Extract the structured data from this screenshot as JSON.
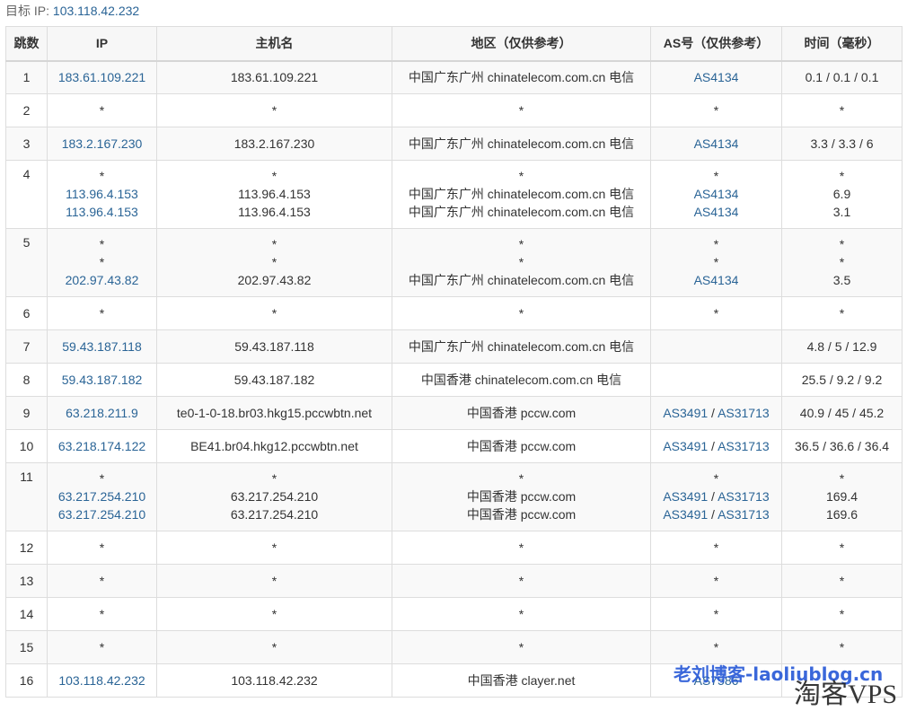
{
  "target": {
    "label": "目标 IP:",
    "ip": "103.118.42.232"
  },
  "headers": [
    "跳数",
    "IP",
    "主机名",
    "地区（仅供参考）",
    "AS号（仅供参考）",
    "时间（毫秒）"
  ],
  "rows": [
    {
      "hop": "1",
      "lines": [
        {
          "ip": "183.61.109.221",
          "host": "183.61.109.221",
          "region": "中国广东广州 chinatelecom.com.cn 电信",
          "as": [
            "AS4134"
          ],
          "time": "0.1 / 0.1 / 0.1"
        }
      ]
    },
    {
      "hop": "2",
      "lines": [
        {
          "ip": "*",
          "host": "*",
          "region": "*",
          "as": [
            "*"
          ],
          "time": "*"
        }
      ]
    },
    {
      "hop": "3",
      "lines": [
        {
          "ip": "183.2.167.230",
          "host": "183.2.167.230",
          "region": "中国广东广州 chinatelecom.com.cn 电信",
          "as": [
            "AS4134"
          ],
          "time": "3.3 / 3.3 / 6"
        }
      ]
    },
    {
      "hop": "4",
      "lines": [
        {
          "ip": "*",
          "host": "*",
          "region": "*",
          "as": [
            "*"
          ],
          "time": "*"
        },
        {
          "ip": "113.96.4.153",
          "host": "113.96.4.153",
          "region": "中国广东广州 chinatelecom.com.cn 电信",
          "as": [
            "AS4134"
          ],
          "time": "6.9"
        },
        {
          "ip": "113.96.4.153",
          "host": "113.96.4.153",
          "region": "中国广东广州 chinatelecom.com.cn 电信",
          "as": [
            "AS4134"
          ],
          "time": "3.1"
        }
      ]
    },
    {
      "hop": "5",
      "lines": [
        {
          "ip": "*",
          "host": "*",
          "region": "*",
          "as": [
            "*"
          ],
          "time": "*"
        },
        {
          "ip": "*",
          "host": "*",
          "region": "*",
          "as": [
            "*"
          ],
          "time": "*"
        },
        {
          "ip": "202.97.43.82",
          "host": "202.97.43.82",
          "region": "中国广东广州 chinatelecom.com.cn 电信",
          "as": [
            "AS4134"
          ],
          "time": "3.5"
        }
      ]
    },
    {
      "hop": "6",
      "lines": [
        {
          "ip": "*",
          "host": "*",
          "region": "*",
          "as": [
            "*"
          ],
          "time": "*"
        }
      ]
    },
    {
      "hop": "7",
      "lines": [
        {
          "ip": "59.43.187.118",
          "host": "59.43.187.118",
          "region": "中国广东广州 chinatelecom.com.cn 电信",
          "as": [],
          "time": "4.8 / 5 / 12.9"
        }
      ]
    },
    {
      "hop": "8",
      "lines": [
        {
          "ip": "59.43.187.182",
          "host": "59.43.187.182",
          "region": "中国香港 chinatelecom.com.cn 电信",
          "as": [],
          "time": "25.5 / 9.2 / 9.2"
        }
      ]
    },
    {
      "hop": "9",
      "lines": [
        {
          "ip": "63.218.211.9",
          "host": "te0-1-0-18.br03.hkg15.pccwbtn.net",
          "region": "中国香港 pccw.com",
          "as": [
            "AS3491",
            "AS31713"
          ],
          "time": "40.9 / 45 / 45.2"
        }
      ]
    },
    {
      "hop": "10",
      "lines": [
        {
          "ip": "63.218.174.122",
          "host": "BE41.br04.hkg12.pccwbtn.net",
          "region": "中国香港 pccw.com",
          "as": [
            "AS3491",
            "AS31713"
          ],
          "time": "36.5 / 36.6 / 36.4"
        }
      ]
    },
    {
      "hop": "11",
      "lines": [
        {
          "ip": "*",
          "host": "*",
          "region": "*",
          "as": [
            "*"
          ],
          "time": "*"
        },
        {
          "ip": "63.217.254.210",
          "host": "63.217.254.210",
          "region": "中国香港 pccw.com",
          "as": [
            "AS3491",
            "AS31713"
          ],
          "time": "169.4"
        },
        {
          "ip": "63.217.254.210",
          "host": "63.217.254.210",
          "region": "中国香港 pccw.com",
          "as": [
            "AS3491",
            "AS31713"
          ],
          "time": "169.6"
        }
      ]
    },
    {
      "hop": "12",
      "lines": [
        {
          "ip": "*",
          "host": "*",
          "region": "*",
          "as": [
            "*"
          ],
          "time": "*"
        }
      ]
    },
    {
      "hop": "13",
      "lines": [
        {
          "ip": "*",
          "host": "*",
          "region": "*",
          "as": [
            "*"
          ],
          "time": "*"
        }
      ]
    },
    {
      "hop": "14",
      "lines": [
        {
          "ip": "*",
          "host": "*",
          "region": "*",
          "as": [
            "*"
          ],
          "time": "*"
        }
      ]
    },
    {
      "hop": "15",
      "lines": [
        {
          "ip": "*",
          "host": "*",
          "region": "*",
          "as": [
            "*"
          ],
          "time": "*"
        }
      ]
    },
    {
      "hop": "16",
      "lines": [
        {
          "ip": "103.118.42.232",
          "host": "103.118.42.232",
          "region": "中国香港 clayer.net",
          "as": [
            "AS7586"
          ],
          "time": ""
        }
      ]
    }
  ],
  "as_separator": "/",
  "watermarks": {
    "blog": "老刘博客-laoliublog.cn",
    "site": "淘客VPS"
  },
  "colors": {
    "link": "#2a6496",
    "border": "#dddddd",
    "stripe": "#f9f9f9"
  }
}
